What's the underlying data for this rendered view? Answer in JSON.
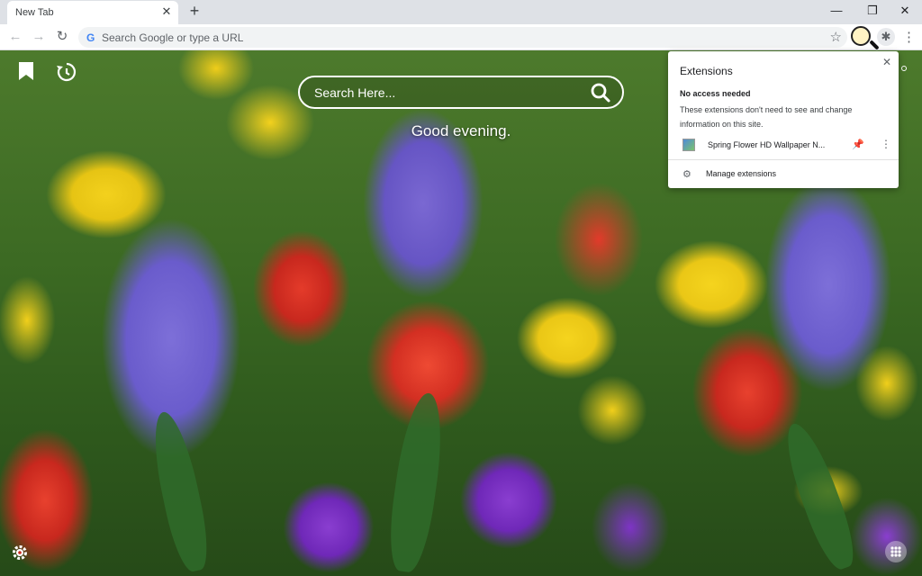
{
  "tab": {
    "title": "New Tab",
    "close": "✕",
    "new_tab": "+"
  },
  "window": {
    "minimize": "—",
    "restore": "❐",
    "close": "✕"
  },
  "toolbar": {
    "back": "←",
    "forward": "→",
    "reload": "↻",
    "google_logo": "G",
    "omnibox_placeholder": "Search Google or type a URL",
    "star": "☆",
    "puzzle": "✱",
    "menu": "⋮"
  },
  "page": {
    "search_placeholder": "Search Here...",
    "greeting": "Good evening."
  },
  "extensions_popup": {
    "title": "Extensions",
    "close": "✕",
    "section_title": "No access needed",
    "section_desc": "These extensions don't need to see and change information on this site.",
    "item_name": "Spring Flower HD Wallpaper N...",
    "pin": "📌",
    "more": "⋮",
    "manage_icon": "⚙",
    "manage_label": "Manage extensions"
  },
  "icons": {
    "bookmark": "bookmark-icon",
    "history": "history-icon",
    "search": "search-icon",
    "settings": "gear-icon",
    "apps": "apps-icon"
  },
  "colors": {
    "tabstrip_bg": "#dee1e6",
    "toolbar_bg": "#ffffff",
    "omnibox_bg": "#f1f3f4",
    "pin_blue": "#1a73e8",
    "popup_bg": "#ffffff"
  }
}
